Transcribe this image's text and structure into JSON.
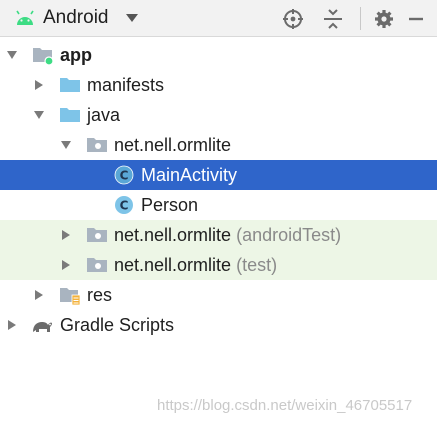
{
  "toolbar": {
    "view_label": "Android",
    "icons": [
      "android-icon",
      "chevron-down-icon",
      "crosshair-icon",
      "collapse-all-icon",
      "gear-icon",
      "minimize-icon"
    ]
  },
  "tree": {
    "rows": [
      {
        "label": "app",
        "suffix": "",
        "icon": "module-folder-icon",
        "expanded": true,
        "selected": false
      },
      {
        "label": "manifests",
        "suffix": "",
        "icon": "folder-icon",
        "expanded": false,
        "selected": false
      },
      {
        "label": "java",
        "suffix": "",
        "icon": "folder-icon",
        "expanded": true,
        "selected": false
      },
      {
        "label": "net.nell.ormlite",
        "suffix": "",
        "icon": "package-icon",
        "expanded": true,
        "selected": false
      },
      {
        "label": "MainActivity",
        "suffix": "",
        "icon": "class-icon",
        "expanded": null,
        "selected": true
      },
      {
        "label": "Person",
        "suffix": "",
        "icon": "class-icon",
        "expanded": null,
        "selected": false
      },
      {
        "label": "net.nell.ormlite",
        "suffix": "(androidTest)",
        "icon": "package-icon",
        "expanded": false,
        "selected": false
      },
      {
        "label": "net.nell.ormlite",
        "suffix": "(test)",
        "icon": "package-icon",
        "expanded": false,
        "selected": false
      },
      {
        "label": "res",
        "suffix": "",
        "icon": "resource-folder-icon",
        "expanded": false,
        "selected": false
      },
      {
        "label": "Gradle Scripts",
        "suffix": "",
        "icon": "gradle-icon",
        "expanded": false,
        "selected": false
      }
    ]
  },
  "watermark": "https://blog.csdn.net/weixin_46705517",
  "colors": {
    "selection": "#2f65ca",
    "test_background": "#edf6e6",
    "folder": "#7ec4e8",
    "class_icon": "#5aa7d6",
    "android_green": "#3ddc84"
  }
}
